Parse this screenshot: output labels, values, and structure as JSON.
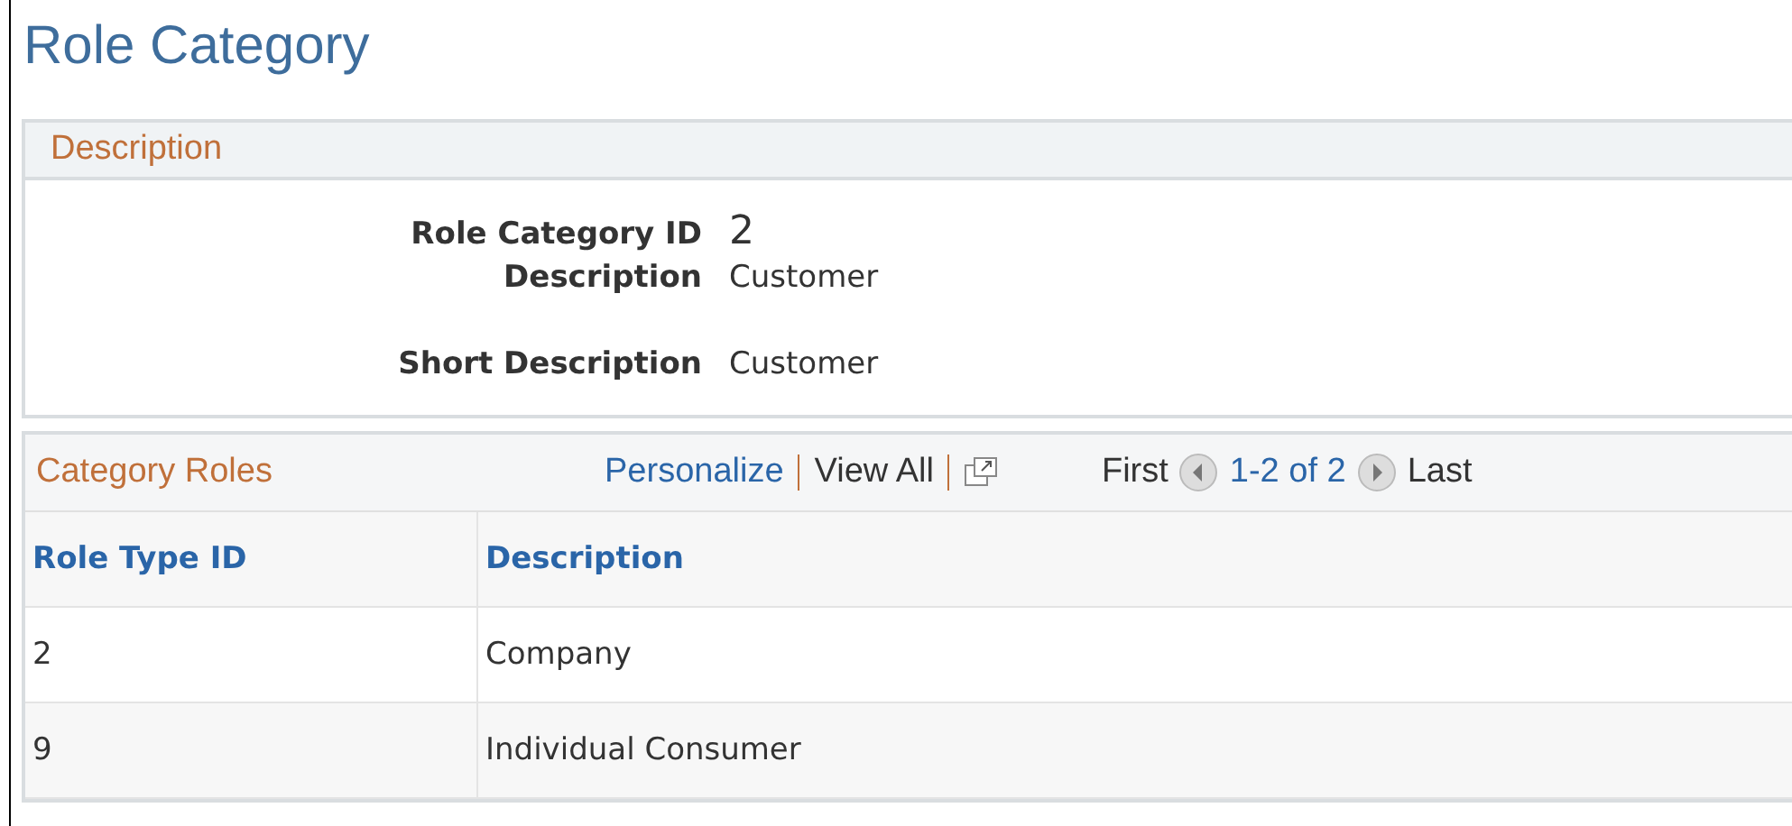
{
  "page_title": "Role Category",
  "description_section": {
    "title": "Description",
    "fields": [
      {
        "label": "Role Category ID",
        "value": "2",
        "kind": "large"
      },
      {
        "label": "Description",
        "value": "Customer",
        "kind": "normal"
      },
      {
        "label": "Short Description",
        "value": "Customer",
        "kind": "normal"
      }
    ]
  },
  "grid": {
    "title": "Category Roles",
    "personalize": "Personalize",
    "view_all": "View All",
    "first": "First",
    "range": "1-2 of 2",
    "last": "Last",
    "columns": [
      "Role Type ID",
      "Description"
    ],
    "rows": [
      [
        "2",
        "Company"
      ],
      [
        "9",
        "Individual Consumer"
      ]
    ]
  }
}
